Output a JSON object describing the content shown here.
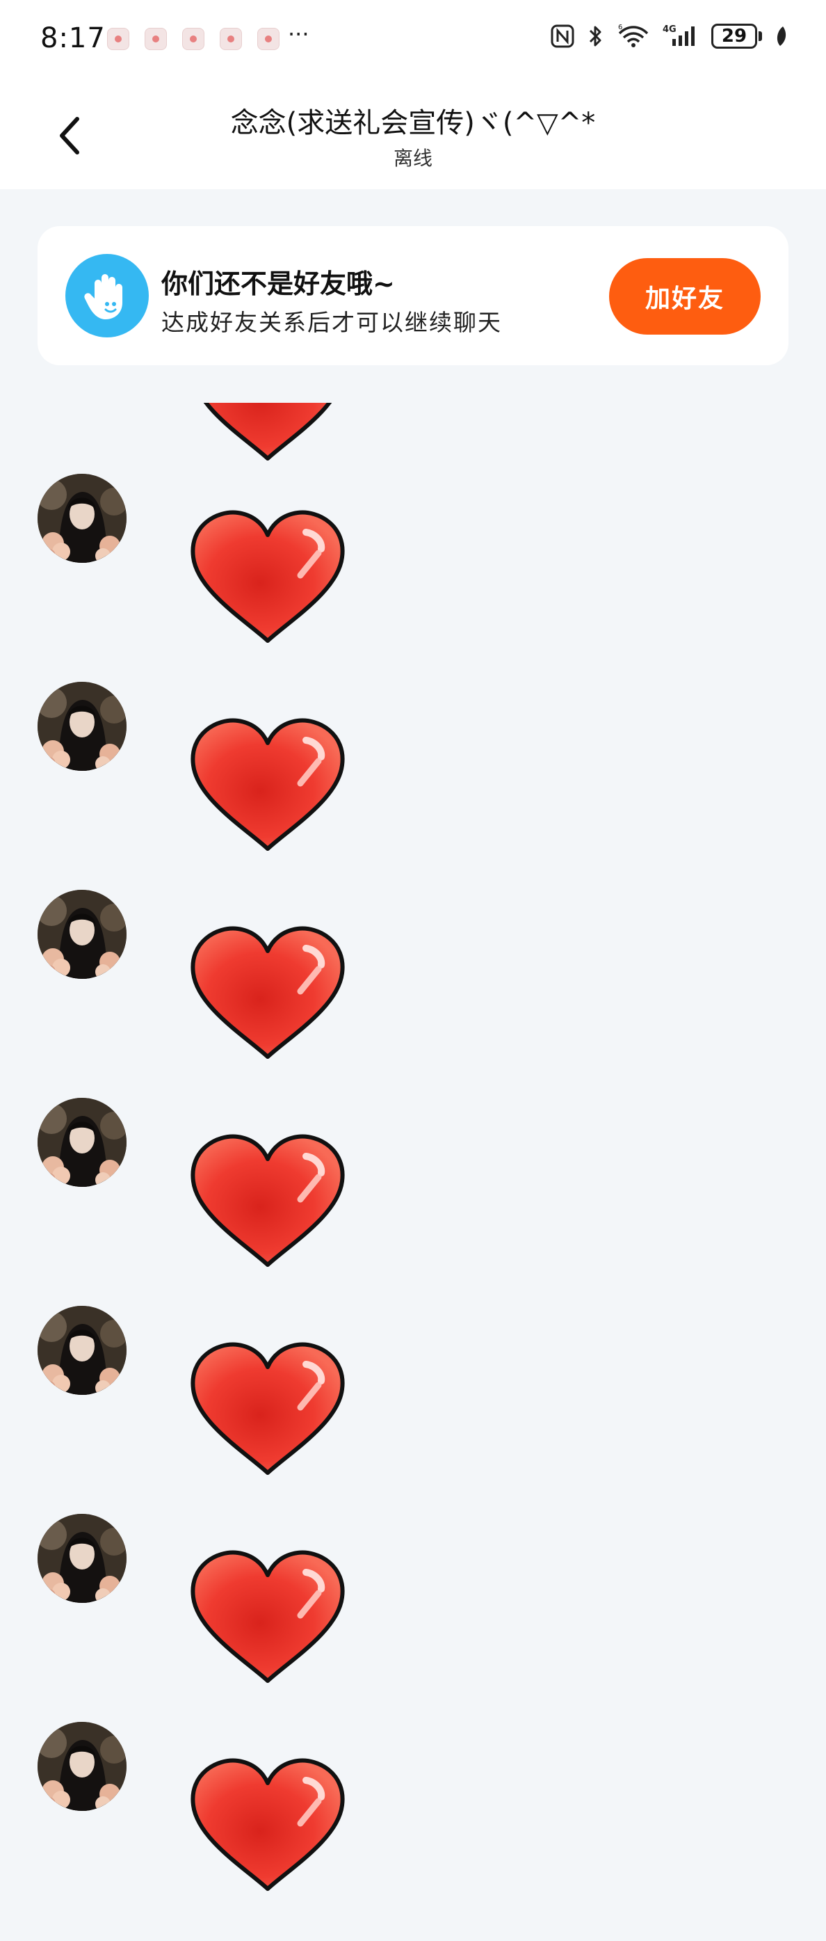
{
  "status_bar": {
    "time": "8:17",
    "more_indicator": "···",
    "notification_icons": [
      "app-notification-icon",
      "app-notification-icon",
      "app-notification-icon",
      "app-notification-icon",
      "app-notification-icon"
    ],
    "battery_level": "29"
  },
  "header": {
    "title": "念念(求送礼会宣传)ヾ(^▽^*",
    "subtitle": "离线"
  },
  "banner": {
    "title": "你们还不是好友哦~",
    "description": "达成好友关系后才可以继续聊天",
    "button_label": "加好友"
  },
  "messages": {
    "count": 7,
    "type": "heart-sticker",
    "sender": "contact"
  },
  "colors": {
    "accent_orange": "#fe5d10",
    "banner_icon_blue": "#35b8f2",
    "heart_red": "#ef3b30",
    "background": "#f3f6f9"
  }
}
